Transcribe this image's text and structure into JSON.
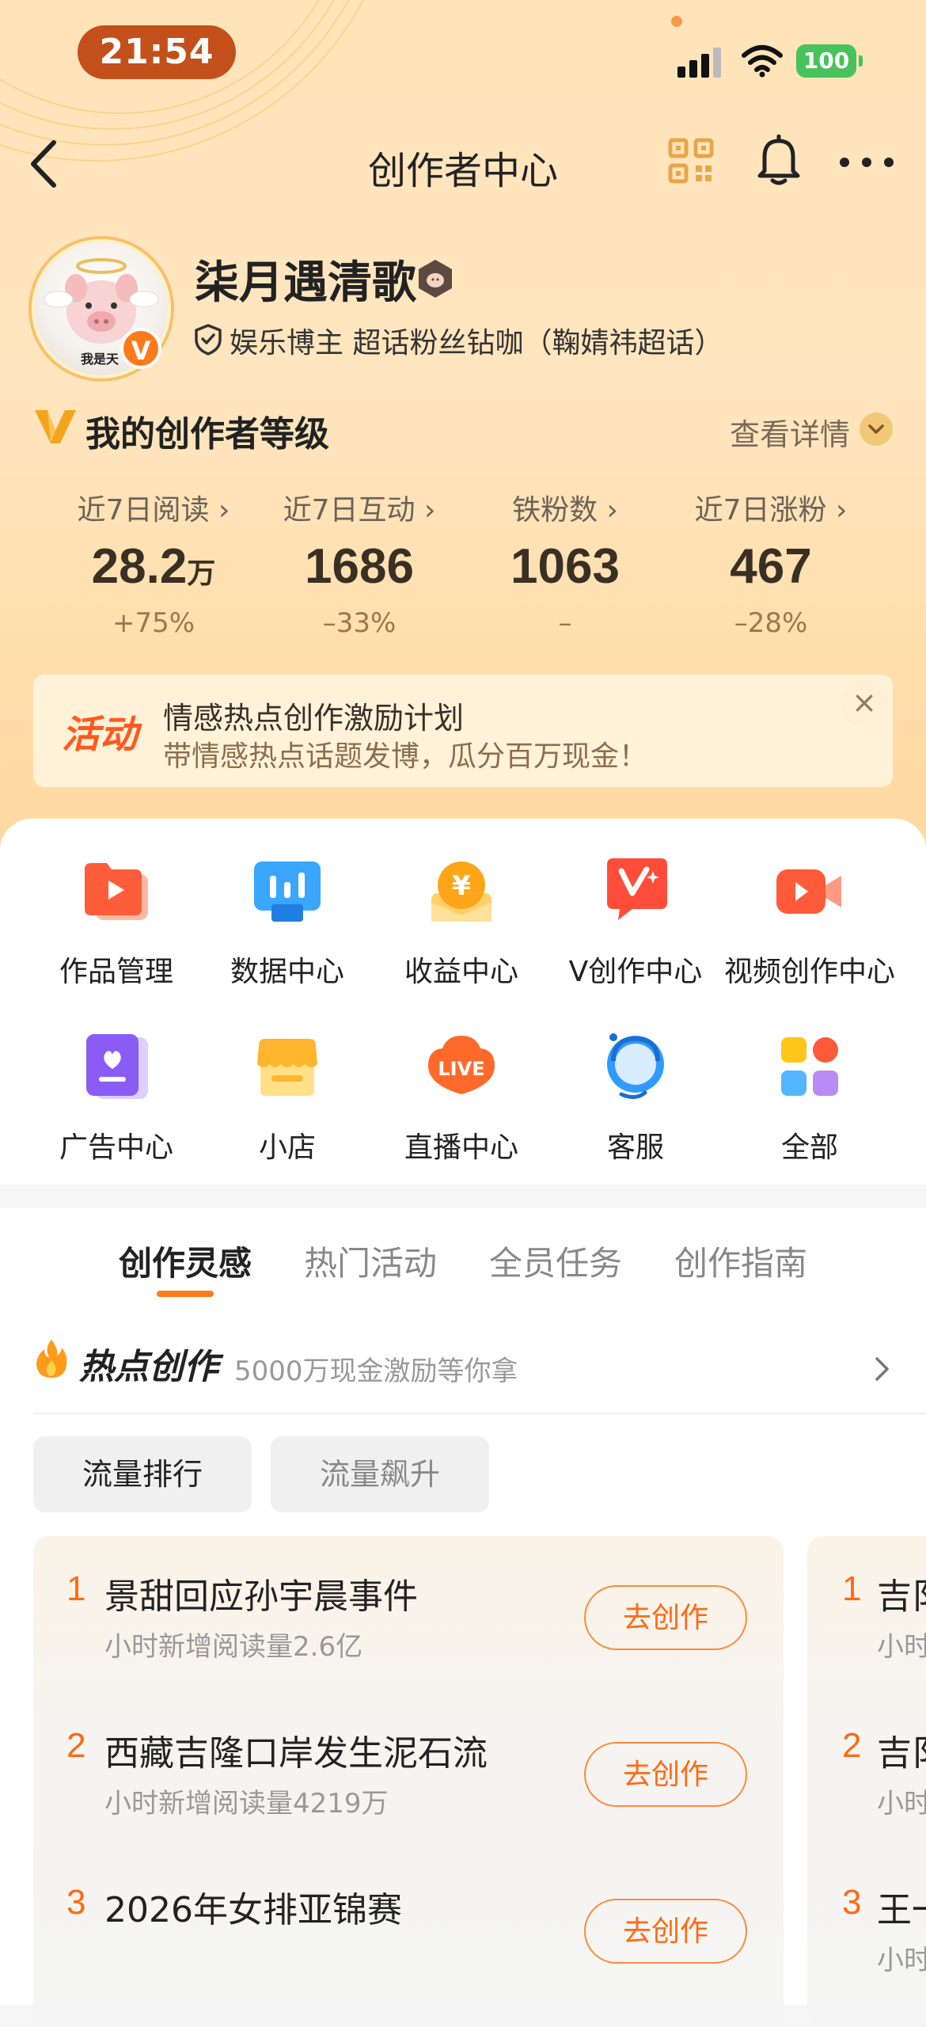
{
  "status_bar": {
    "time": "21:54",
    "battery": "100"
  },
  "nav": {
    "title": "创作者中心",
    "icons": [
      "back-arrow-icon",
      "qr-code-icon",
      "bell-icon",
      "more-icon"
    ]
  },
  "profile": {
    "name": "柒月遇清歌",
    "tagline": "娱乐博主 超话粉丝钻咖（鞠婧祎超话）",
    "avatar_caption": "我是天"
  },
  "level": {
    "title": "我的创作者等级",
    "view_detail": "查看详情"
  },
  "stats": [
    {
      "label": "近7日阅读 ›",
      "value": "28.2",
      "unit": "万",
      "change": "+75%"
    },
    {
      "label": "近7日互动 ›",
      "value": "1686",
      "unit": "",
      "change": "–33%"
    },
    {
      "label": "铁粉数 ›",
      "value": "1063",
      "unit": "",
      "change": "–"
    },
    {
      "label": "近7日涨粉 ›",
      "value": "467",
      "unit": "",
      "change": "–28%"
    }
  ],
  "banner": {
    "tag": "活动",
    "title": "情感热点创作激励计划",
    "subtitle": "带情感热点话题发博，瓜分百万现金！",
    "close": "×"
  },
  "tools": [
    {
      "label": "作品管理",
      "icon": "works-icon"
    },
    {
      "label": "数据中心",
      "icon": "data-icon"
    },
    {
      "label": "收益中心",
      "icon": "income-icon"
    },
    {
      "label": "V创作中心",
      "icon": "v-create-icon"
    },
    {
      "label": "视频创作中心",
      "icon": "video-icon"
    },
    {
      "label": "广告中心",
      "icon": "ad-icon"
    },
    {
      "label": "小店",
      "icon": "shop-icon"
    },
    {
      "label": "直播中心",
      "icon": "live-icon"
    },
    {
      "label": "客服",
      "icon": "service-icon"
    },
    {
      "label": "全部",
      "icon": "all-icon"
    }
  ],
  "tabs": [
    "创作灵感",
    "热门活动",
    "全员任务",
    "创作指南"
  ],
  "hot": {
    "title": "热点创作",
    "subtitle": "5000万现金激励等你拿"
  },
  "filters": [
    "流量排行",
    "流量飙升"
  ],
  "ranking": [
    {
      "rank": "1",
      "title": "景甜回应孙宇晨事件",
      "sub": "小时新增阅读量2.6亿",
      "button": "去创作"
    },
    {
      "rank": "2",
      "title": "西藏吉隆口岸发生泥石流",
      "sub": "小时新增阅读量4219万",
      "button": "去创作"
    },
    {
      "rank": "3",
      "title": "2026年女排亚锦赛",
      "sub": "",
      "button": "去创作"
    }
  ],
  "ranking_peek": [
    {
      "rank": "1",
      "title": "吉阝",
      "sub": "小时"
    },
    {
      "rank": "2",
      "title": "吉阝",
      "sub": "小时"
    },
    {
      "rank": "3",
      "title": "王一",
      "sub": "小时"
    }
  ],
  "colors": {
    "accent": "#ff6a13",
    "header_bg": "#ffe4b9",
    "time_pill": "#c3501a"
  }
}
